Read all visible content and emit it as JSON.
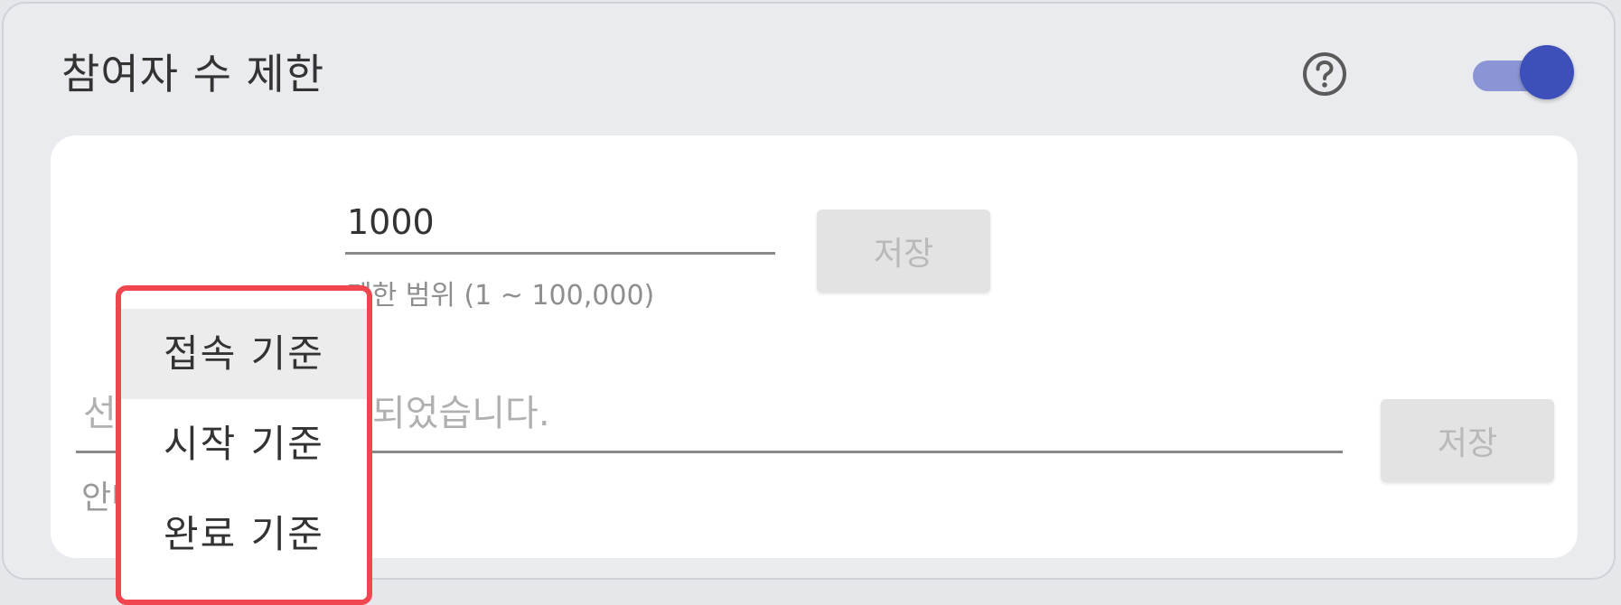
{
  "header": {
    "title": "참여자 수 제한",
    "help_icon": "question-circle-icon",
    "toggle_on": true
  },
  "limit": {
    "value": "1000",
    "hint": "제한 범위 (1 ~ 100,000)",
    "save_label": "저장"
  },
  "message": {
    "placeholder": "선착순 모집이 마감되었습니다.",
    "label": "안내 문구",
    "save_label": "저장"
  },
  "dropdown": {
    "options": [
      "접속 기준",
      "시작 기준",
      "완료 기준"
    ],
    "selected_index": 0
  },
  "colors": {
    "accent": "#3c4fba",
    "toggle_track": "#8b95d6",
    "highlight_border": "#f0464f"
  }
}
